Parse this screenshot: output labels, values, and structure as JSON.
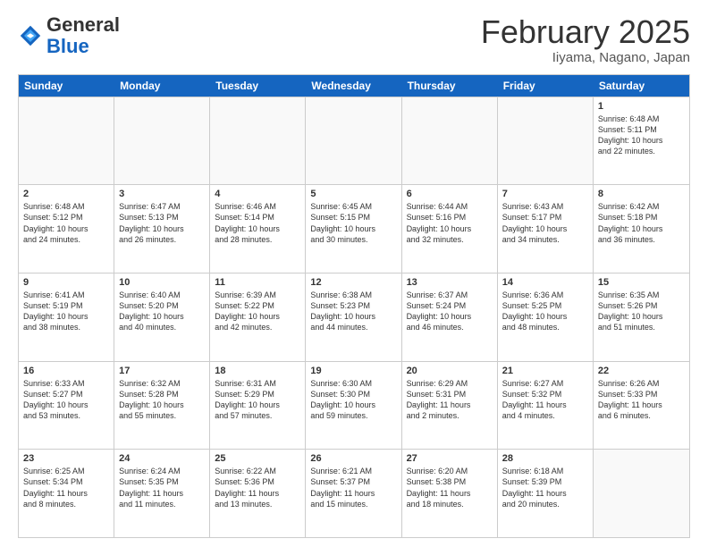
{
  "header": {
    "logo_general": "General",
    "logo_blue": "Blue",
    "month_year": "February 2025",
    "location": "Iiyama, Nagano, Japan"
  },
  "days_of_week": [
    "Sunday",
    "Monday",
    "Tuesday",
    "Wednesday",
    "Thursday",
    "Friday",
    "Saturday"
  ],
  "weeks": [
    [
      {
        "day": "",
        "info": ""
      },
      {
        "day": "",
        "info": ""
      },
      {
        "day": "",
        "info": ""
      },
      {
        "day": "",
        "info": ""
      },
      {
        "day": "",
        "info": ""
      },
      {
        "day": "",
        "info": ""
      },
      {
        "day": "1",
        "info": "Sunrise: 6:48 AM\nSunset: 5:11 PM\nDaylight: 10 hours\nand 22 minutes."
      }
    ],
    [
      {
        "day": "2",
        "info": "Sunrise: 6:48 AM\nSunset: 5:12 PM\nDaylight: 10 hours\nand 24 minutes."
      },
      {
        "day": "3",
        "info": "Sunrise: 6:47 AM\nSunset: 5:13 PM\nDaylight: 10 hours\nand 26 minutes."
      },
      {
        "day": "4",
        "info": "Sunrise: 6:46 AM\nSunset: 5:14 PM\nDaylight: 10 hours\nand 28 minutes."
      },
      {
        "day": "5",
        "info": "Sunrise: 6:45 AM\nSunset: 5:15 PM\nDaylight: 10 hours\nand 30 minutes."
      },
      {
        "day": "6",
        "info": "Sunrise: 6:44 AM\nSunset: 5:16 PM\nDaylight: 10 hours\nand 32 minutes."
      },
      {
        "day": "7",
        "info": "Sunrise: 6:43 AM\nSunset: 5:17 PM\nDaylight: 10 hours\nand 34 minutes."
      },
      {
        "day": "8",
        "info": "Sunrise: 6:42 AM\nSunset: 5:18 PM\nDaylight: 10 hours\nand 36 minutes."
      }
    ],
    [
      {
        "day": "9",
        "info": "Sunrise: 6:41 AM\nSunset: 5:19 PM\nDaylight: 10 hours\nand 38 minutes."
      },
      {
        "day": "10",
        "info": "Sunrise: 6:40 AM\nSunset: 5:20 PM\nDaylight: 10 hours\nand 40 minutes."
      },
      {
        "day": "11",
        "info": "Sunrise: 6:39 AM\nSunset: 5:22 PM\nDaylight: 10 hours\nand 42 minutes."
      },
      {
        "day": "12",
        "info": "Sunrise: 6:38 AM\nSunset: 5:23 PM\nDaylight: 10 hours\nand 44 minutes."
      },
      {
        "day": "13",
        "info": "Sunrise: 6:37 AM\nSunset: 5:24 PM\nDaylight: 10 hours\nand 46 minutes."
      },
      {
        "day": "14",
        "info": "Sunrise: 6:36 AM\nSunset: 5:25 PM\nDaylight: 10 hours\nand 48 minutes."
      },
      {
        "day": "15",
        "info": "Sunrise: 6:35 AM\nSunset: 5:26 PM\nDaylight: 10 hours\nand 51 minutes."
      }
    ],
    [
      {
        "day": "16",
        "info": "Sunrise: 6:33 AM\nSunset: 5:27 PM\nDaylight: 10 hours\nand 53 minutes."
      },
      {
        "day": "17",
        "info": "Sunrise: 6:32 AM\nSunset: 5:28 PM\nDaylight: 10 hours\nand 55 minutes."
      },
      {
        "day": "18",
        "info": "Sunrise: 6:31 AM\nSunset: 5:29 PM\nDaylight: 10 hours\nand 57 minutes."
      },
      {
        "day": "19",
        "info": "Sunrise: 6:30 AM\nSunset: 5:30 PM\nDaylight: 10 hours\nand 59 minutes."
      },
      {
        "day": "20",
        "info": "Sunrise: 6:29 AM\nSunset: 5:31 PM\nDaylight: 11 hours\nand 2 minutes."
      },
      {
        "day": "21",
        "info": "Sunrise: 6:27 AM\nSunset: 5:32 PM\nDaylight: 11 hours\nand 4 minutes."
      },
      {
        "day": "22",
        "info": "Sunrise: 6:26 AM\nSunset: 5:33 PM\nDaylight: 11 hours\nand 6 minutes."
      }
    ],
    [
      {
        "day": "23",
        "info": "Sunrise: 6:25 AM\nSunset: 5:34 PM\nDaylight: 11 hours\nand 8 minutes."
      },
      {
        "day": "24",
        "info": "Sunrise: 6:24 AM\nSunset: 5:35 PM\nDaylight: 11 hours\nand 11 minutes."
      },
      {
        "day": "25",
        "info": "Sunrise: 6:22 AM\nSunset: 5:36 PM\nDaylight: 11 hours\nand 13 minutes."
      },
      {
        "day": "26",
        "info": "Sunrise: 6:21 AM\nSunset: 5:37 PM\nDaylight: 11 hours\nand 15 minutes."
      },
      {
        "day": "27",
        "info": "Sunrise: 6:20 AM\nSunset: 5:38 PM\nDaylight: 11 hours\nand 18 minutes."
      },
      {
        "day": "28",
        "info": "Sunrise: 6:18 AM\nSunset: 5:39 PM\nDaylight: 11 hours\nand 20 minutes."
      },
      {
        "day": "",
        "info": ""
      }
    ]
  ]
}
